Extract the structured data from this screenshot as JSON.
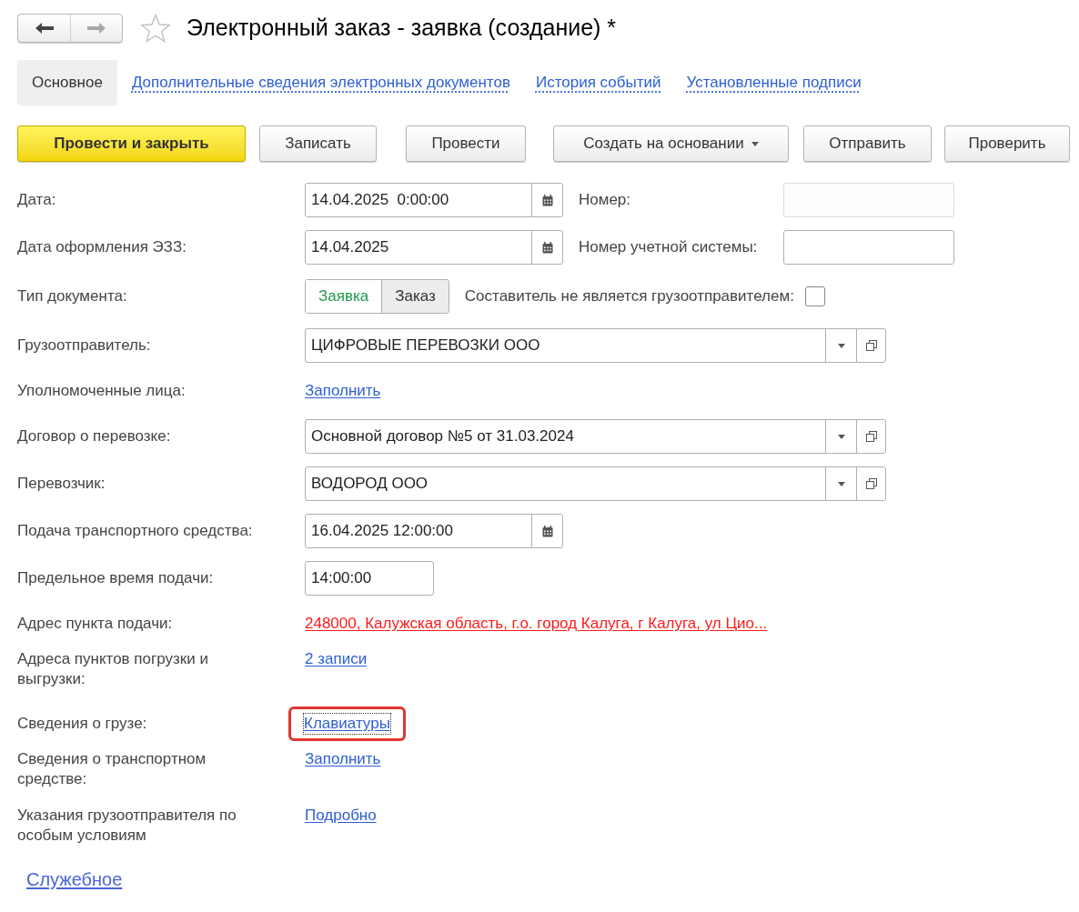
{
  "window": {
    "title": "Электронный заказ - заявка (создание) *",
    "favorite": false
  },
  "tabs": [
    {
      "label": "Основное",
      "selected": true
    },
    {
      "label": "Дополнительные сведения электронных документов",
      "selected": false
    },
    {
      "label": "История событий",
      "selected": false
    },
    {
      "label": "Установленные подписи",
      "selected": false
    }
  ],
  "buttons": [
    {
      "label": "Провести и закрыть",
      "kind": "primary"
    },
    {
      "label": "Записать",
      "kind": "default"
    },
    {
      "label": "Провести",
      "kind": "default"
    },
    {
      "label": "Создать на основании",
      "kind": "dropdown"
    },
    {
      "label": "Отправить",
      "kind": "default"
    },
    {
      "label": "Проверить",
      "kind": "default"
    }
  ],
  "rows": [
    {
      "label": "Дата:",
      "kind": "date",
      "value": "14.04.2025  0:00:00",
      "side": {
        "kind": "field",
        "label": "Номер:",
        "disabled": true
      }
    },
    {
      "label": "Дата оформления ЭЗЗ:",
      "kind": "date",
      "value": "14.04.2025",
      "side": {
        "kind": "field",
        "label": "Номер учетной системы:",
        "disabled": false
      }
    },
    {
      "label": "Тип документа:",
      "kind": "toggle",
      "options": [
        {
          "label": "Заявка",
          "selected": true
        },
        {
          "label": "Заказ",
          "selected": false
        }
      ],
      "side": {
        "kind": "checkbox",
        "label": "Составитель не является грузоотправителем:",
        "checked": false
      }
    },
    {
      "label": "Грузоотправитель:",
      "kind": "select",
      "value": "ЦИФРОВЫЕ ПЕРЕВОЗКИ ООО"
    },
    {
      "label": "Уполномоченные лица:",
      "kind": "link",
      "value": "Заполнить",
      "invalid": false,
      "highlighted": false
    },
    {
      "label": "Договор о перевозке:",
      "kind": "select",
      "value": "Основной договор №5 от 31.03.2024"
    },
    {
      "label": "Перевозчик:",
      "kind": "select",
      "value": "ВОДОРОД ООО"
    },
    {
      "label": "Подача транспортного средства:",
      "kind": "date",
      "value": "16.04.2025 12:00:00"
    },
    {
      "label": "Предельное время подачи:",
      "kind": "time",
      "value": "14:00:00"
    },
    {
      "label": "Адрес пункта подачи:",
      "kind": "link",
      "value": "248000, Калужская область, г.о. город Калуга, г Калуга, ул Цио...",
      "invalid": true,
      "highlighted": false
    },
    {
      "label": "Адреса пунктов погрузки и выгрузки:",
      "kind": "link",
      "value": "2 записи",
      "invalid": false,
      "highlighted": false
    },
    {
      "label": "Сведения о грузе:",
      "kind": "link",
      "value": "Клавиатуры",
      "invalid": false,
      "highlighted": true
    },
    {
      "label": "Сведения о транспортном средстве:",
      "kind": "link",
      "value": "Заполнить",
      "invalid": false,
      "highlighted": false
    },
    {
      "label": "Указания грузоотправителя по особым условиям",
      "kind": "link",
      "value": "Подробно",
      "invalid": false,
      "highlighted": false
    }
  ],
  "footer_link": "Служебное"
}
